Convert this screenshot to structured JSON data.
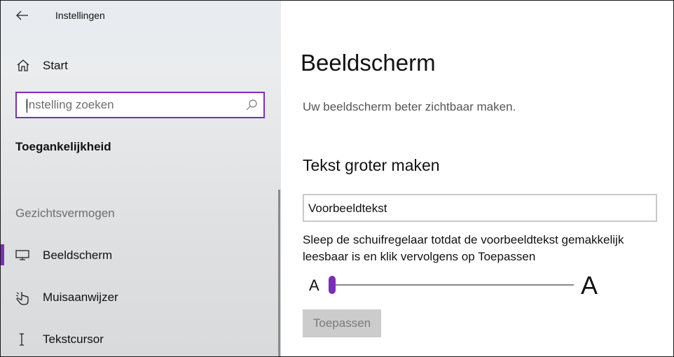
{
  "app": {
    "title": "Instellingen"
  },
  "sidebar": {
    "home_label": "Start",
    "search": {
      "placeholder": "Instelling zoeken",
      "value": ""
    },
    "section_heading": "Toegankelijkheid",
    "group_heading": "Gezichtsvermogen",
    "items": [
      {
        "label": "Beeldscherm",
        "icon": "display-icon",
        "selected": true
      },
      {
        "label": "Muisaanwijzer",
        "icon": "mouse-pointer-icon",
        "selected": false
      },
      {
        "label": "Tekstcursor",
        "icon": "text-cursor-icon",
        "selected": false
      }
    ]
  },
  "main": {
    "title": "Beeldscherm",
    "description": "Uw beeldscherm beter zichtbaar maken.",
    "text_size": {
      "heading": "Tekst groter maken",
      "preview_text": "Voorbeeldtekst",
      "instruction": "Sleep de schuifregelaar totdat de voorbeeldtekst gemakkelijk leesbaar is en klik vervolgens op Toepassen",
      "slider_min_label": "A",
      "slider_max_label": "A",
      "slider_value_fraction": 0.0,
      "apply_label": "Toepassen"
    }
  },
  "colors": {
    "accent": "#7b2fb8",
    "disabled_button": "#cccccc"
  }
}
